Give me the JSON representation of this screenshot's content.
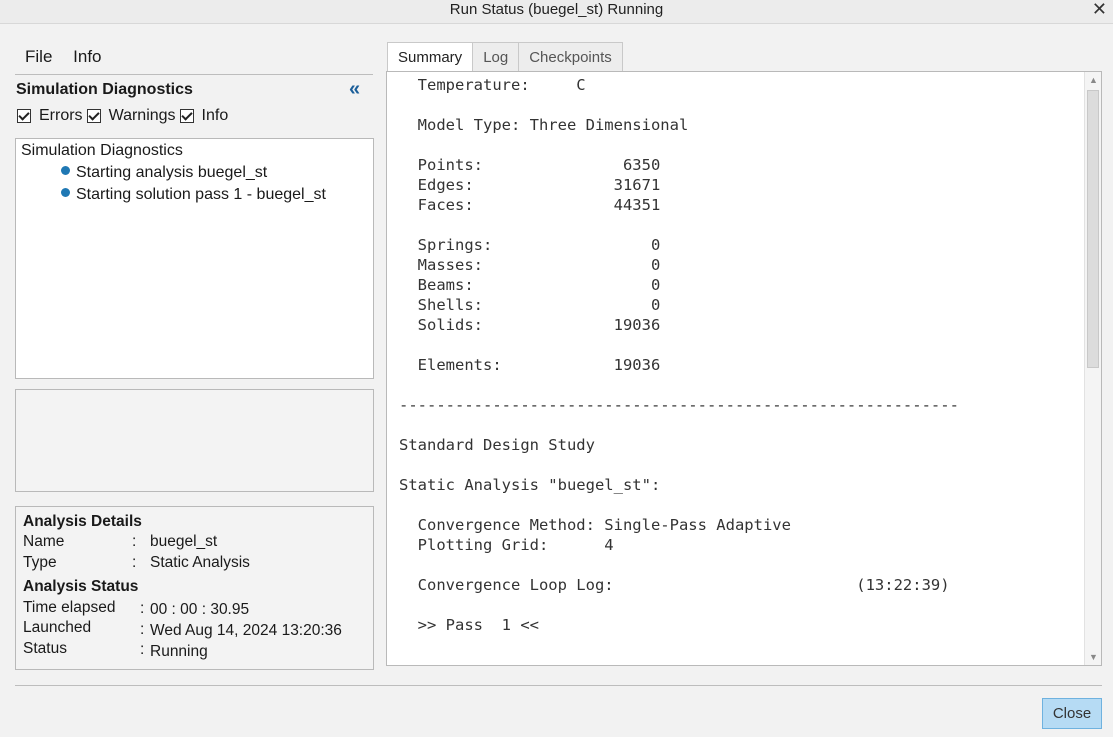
{
  "window": {
    "title": "Run Status (buegel_st) Running",
    "close_glyph": "✕"
  },
  "menu": {
    "file": "File",
    "info": "Info"
  },
  "diagnostics": {
    "title": "Simulation Diagnostics",
    "collapse_glyph": "«",
    "filters": [
      {
        "label": "Errors",
        "checked": true
      },
      {
        "label": "Warnings",
        "checked": true
      },
      {
        "label": "Info",
        "checked": true
      }
    ],
    "tree_root": "Simulation Diagnostics",
    "items": [
      "Starting analysis buegel_st",
      "Starting solution pass 1 - buegel_st"
    ]
  },
  "details": {
    "analysis_header": "Analysis Details",
    "name_label": "Name",
    "name_value": "buegel_st",
    "type_label": "Type",
    "type_value": "Static Analysis",
    "status_header": "Analysis Status",
    "elapsed_label": "Time elapsed",
    "elapsed_value": "00 : 00 : 30.95",
    "launched_label": "Launched",
    "launched_value": "Wed Aug 14, 2024   13:20:36",
    "status_label": "Status",
    "status_value": "Running",
    "colon": ":"
  },
  "tabs": [
    {
      "label": "Summary",
      "active": true
    },
    {
      "label": "Log",
      "active": false
    },
    {
      "label": "Checkpoints",
      "active": false
    }
  ],
  "summary_lines": [
    "  Temperature:     C",
    "",
    "  Model Type: Three Dimensional",
    "",
    "  Points:               6350",
    "  Edges:               31671",
    "  Faces:               44351",
    "",
    "  Springs:                 0",
    "  Masses:                  0",
    "  Beams:                   0",
    "  Shells:                  0",
    "  Solids:              19036",
    "",
    "  Elements:            19036",
    "",
    "------------------------------------------------------------",
    "",
    "Standard Design Study",
    "",
    "Static Analysis \"buegel_st\":",
    "",
    "  Convergence Method: Single-Pass Adaptive",
    "  Plotting Grid:      4",
    "",
    "  Convergence Loop Log:                          (13:22:39)",
    "",
    "  >> Pass  1 <<"
  ],
  "buttons": {
    "close": "Close"
  },
  "colors": {
    "accent": "#1f78b4",
    "close_button_bg": "#b6dbf4"
  }
}
